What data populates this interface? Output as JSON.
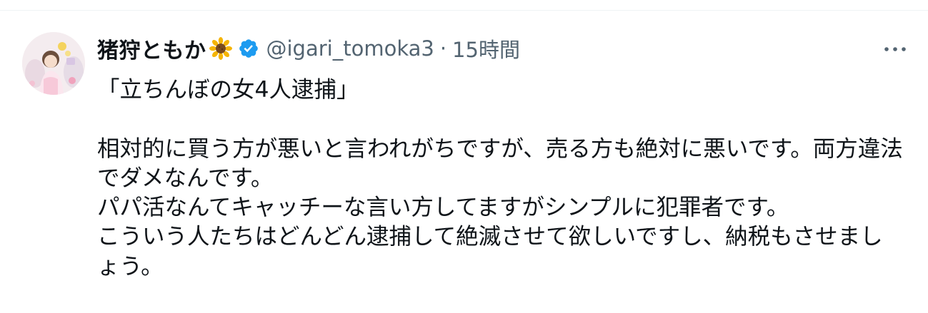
{
  "tweet": {
    "author": {
      "display_name": "猪狩ともか",
      "name_emoji": "sunflower-icon",
      "verified": true,
      "verified_icon": "verified-badge-icon",
      "handle": "@igari_tomoka3",
      "separator": "·",
      "timestamp": "15時間"
    },
    "menu_icon": "more-horizontal-icon",
    "text": "「立ちんぼの女4人逮捕」\n\n相対的に買う方が悪いと言われがちですが、売る方も絶対に悪いです。両方違法でダメなんです。\nパパ活なんてキャッチーな言い方してますがシンプルに犯罪者です。\nこういう人たちはどんどん逮捕して絶滅させて欲しいですし、納税もさせましょう。"
  },
  "colors": {
    "text_primary": "#0f1419",
    "text_secondary": "#536471",
    "verified_blue": "#1d9bf0",
    "divider": "#eff3f4"
  }
}
